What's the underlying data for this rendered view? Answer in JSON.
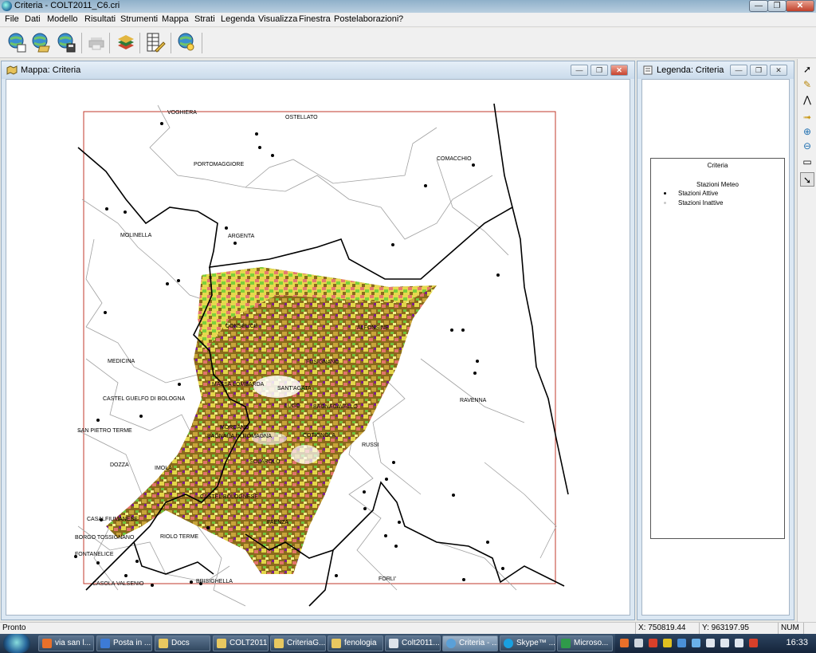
{
  "window": {
    "title": "Criteria - COLT2011_C6.cri",
    "min": "—",
    "max": "❐",
    "close": "✕"
  },
  "menu": [
    "File",
    "Dati",
    "Modello",
    "Risultati",
    "Strumenti",
    "Mappa",
    "Strati",
    "Legenda",
    "Visualizza",
    "Finestra",
    "Postelaborazioni",
    "?"
  ],
  "toolbar": {
    "icons": [
      "globe-new-icon",
      "globe-open-icon",
      "globe-save-icon",
      "print-icon",
      "layers-icon",
      "table-edit-icon",
      "globe-search-icon"
    ]
  },
  "map_window": {
    "title": "Mappa: Criteria",
    "labels": [
      "VOGHIERA",
      "OSTELLATO",
      "PORTOMAGGIORE",
      "COMACCHIO",
      "MOLINELLA",
      "ARGENTA",
      "CONSELICE",
      "ALFONSINE",
      "MEDICINA",
      "FUSIGNANO",
      "MASSA LOMBARDA",
      "SANT'AGATA",
      "CASTEL GUELFO DI BOLOGNA",
      "LUGO",
      "BAGNACAVALLO",
      "RAVENNA",
      "SAN PIETRO TERME",
      "MORDANO",
      "COTIGNOLA",
      "BAGNARA DI ROMAGNA",
      "RUSSI",
      "DOZZA",
      "IMOLA",
      "SOLAROLO",
      "CASTEL BOLOGNESE",
      "CASALFIUMANESE",
      "FAENZA",
      "BORGO TOSSIGNANO",
      "RIOLO TERME",
      "FONTANELICE",
      "CASOLA VALSENIO",
      "BRISIGHELLA",
      "FORLI'"
    ]
  },
  "legend_window": {
    "title": "Legenda: Criteria",
    "legend_title": "Criteria",
    "group": "Stazioni Meteo",
    "items": [
      {
        "label": "Stazioni Attive",
        "color": "#000000"
      },
      {
        "label": "Stazioni Inattive",
        "color": "#c8c8c8"
      }
    ]
  },
  "tools": [
    "pointer-icon",
    "pen-icon",
    "measure-icon",
    "pan-icon",
    "zoom-in-icon",
    "zoom-out-icon",
    "select-rect-icon",
    "info-cursor-icon"
  ],
  "status": {
    "text": "Pronto",
    "x": "X: 750819.44",
    "y": "Y: 963197.95",
    "num": "NUM"
  },
  "taskbar": {
    "tasks": [
      {
        "label": "via san l...",
        "color": "#e8702a"
      },
      {
        "label": "Posta in ...",
        "color": "#3d7bd6"
      },
      {
        "label": "Docs",
        "color": "#e8c860"
      },
      {
        "label": "COLT2011",
        "color": "#e8c860"
      },
      {
        "label": "CriteriaG...",
        "color": "#e8c860"
      },
      {
        "label": "fenologia",
        "color": "#e8c860"
      },
      {
        "label": "Colt2011...",
        "color": "#dde3ea"
      },
      {
        "label": "Criteria - ...",
        "color": "#5aa0d8"
      },
      {
        "label": "Skype™ ...",
        "color": "#19a0e0"
      },
      {
        "label": "Microso...",
        "color": "#2f9a4a"
      }
    ],
    "clock": "16:33"
  }
}
